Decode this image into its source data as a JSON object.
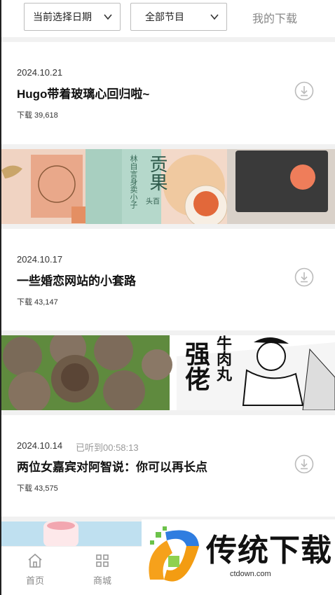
{
  "filters": {
    "date_dropdown": "当前选择日期",
    "program_dropdown": "全部节目",
    "my_downloads": "我的下载"
  },
  "episodes": [
    {
      "date": "2024.10.21",
      "heard": "",
      "title": "Hugo带着玻璃心回归啦~",
      "count_label": "下载 39,618"
    },
    {
      "date": "2024.10.17",
      "heard": "",
      "title": "一些婚恋网站的小套路",
      "count_label": "下载 43,147"
    },
    {
      "date": "2024.10.14",
      "heard": "已听到00:58:13",
      "title": "两位女嘉宾对阿智说：你可以再长点",
      "count_label": "下载 43,575"
    }
  ],
  "banners": {
    "one": {
      "brand_text": "贡果",
      "sub_text": "头百",
      "vertical_text": "林自言身卖小子"
    },
    "two": {
      "brand_text": "强佬",
      "vertical_text": "牛肉丸"
    }
  },
  "bottom_nav": {
    "items": [
      {
        "label": "首页",
        "icon": "home-icon"
      },
      {
        "label": "商城",
        "icon": "grid-icon"
      }
    ]
  },
  "watermark": {
    "text": "传统下载",
    "url": "ctdown.com"
  }
}
